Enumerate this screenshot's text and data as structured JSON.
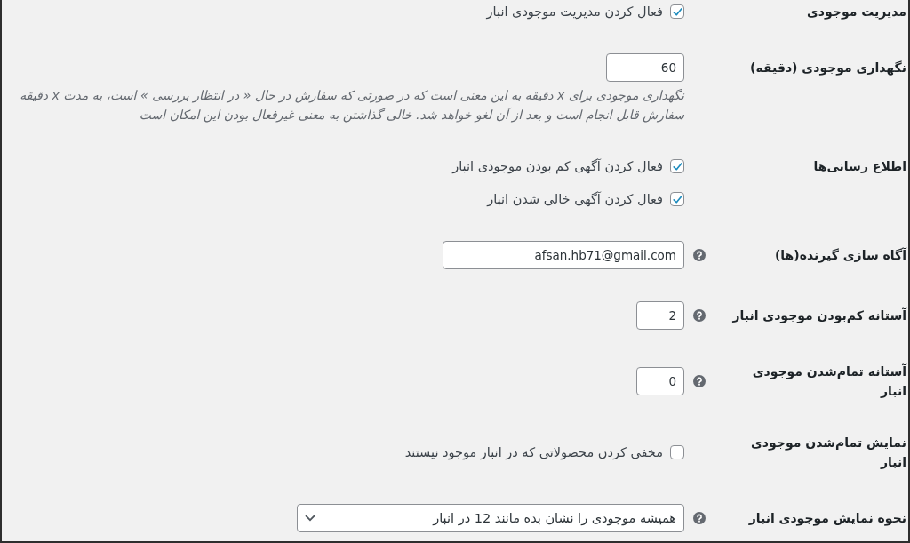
{
  "settings": [
    {
      "label": "مدیریت موجودی",
      "help_tip": false,
      "kind": "checkboxes",
      "options": [
        {
          "text": "فعال کردن مدیریت موجودی انبار",
          "checked": true
        }
      ]
    },
    {
      "label": "نگهداری موجودی (دقیقه)",
      "help_tip": false,
      "kind": "input",
      "value": "60",
      "description": "نگهداری موجودی برای x دقیقه به این معنی است که در صورتی که سفارش در حال « در انتظار بررسی » است، به مدت x دقیقه سفارش قابل انجام است و بعد از آن لغو خواهد شد. خالی گذاشتن به معنی غیرفعال بودن این امکان است"
    },
    {
      "label": "اطلاع رسانی‌ها",
      "help_tip": false,
      "kind": "checkboxes",
      "options": [
        {
          "text": "فعال کردن آگهی کم بودن موجودی انبار",
          "checked": true
        },
        {
          "text": "فعال کردن آگهی خالی شدن انبار",
          "checked": true
        }
      ]
    },
    {
      "label": "آگاه سازی گیرنده(ها)",
      "help_tip": true,
      "kind": "input",
      "value": "afsan.hb71@gmail.com"
    },
    {
      "label": "آستانه کم‌بودن موجودی انبار",
      "help_tip": true,
      "kind": "input",
      "value": "2"
    },
    {
      "label": "آستانه تمام‌شدن موجودی انبار",
      "help_tip": true,
      "kind": "input",
      "value": "0"
    },
    {
      "label": "نمایش تمام‌شدن موجودی انبار",
      "help_tip": false,
      "kind": "checkboxes",
      "options": [
        {
          "text": "مخفی کردن محصولاتی که در انبار موجود نیستند",
          "checked": false
        }
      ]
    },
    {
      "label": "نحوه نمایش موجودی انبار",
      "help_tip": true,
      "kind": "select",
      "value": "همیشه موجودی را نشان بده مانند 12 در انبار"
    }
  ]
}
